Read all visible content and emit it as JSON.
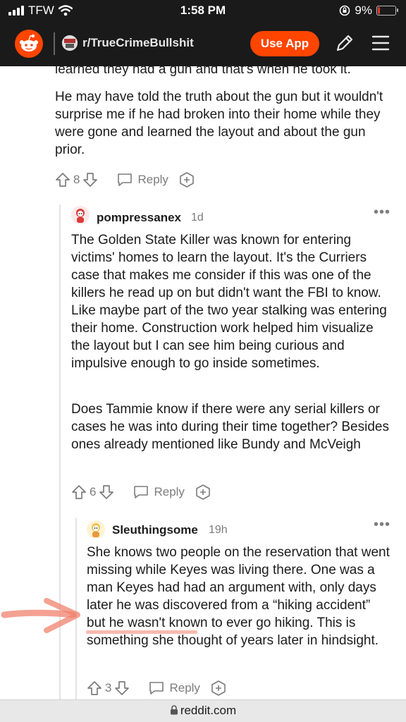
{
  "status": {
    "carrier": "TFW",
    "time": "1:58 PM",
    "battery": "9%",
    "battery_level": 0.09
  },
  "header": {
    "subreddit": "r/TrueCrimeBullshit",
    "use_app": "Use App"
  },
  "post_tail": {
    "clipped_line": "learned they had a gun and that's when he took it.",
    "paragraph": "He may have told the truth about the gun but it wouldn't surprise me if he had broken into their home while they were gone and learned the layout and about the gun prior.",
    "votes": "8",
    "reply": "Reply"
  },
  "comment1": {
    "username": "pompressanex",
    "time": "1d",
    "para1": "The Golden State Killer was known for entering victims' homes to learn the layout. It's the Curriers case that makes me consider if this was one of the killers he read up on but didn't want the FBI to know. Like maybe part of the two year stalking was entering their home. Construction work helped him visualize the layout but I can see him being curious and impulsive enough to go inside sometimes.",
    "para2": "Does Tammie know if there were any serial killers or cases he was into during their time together? Besides ones already mentioned like Bundy and McVeigh",
    "votes": "6",
    "reply": "Reply"
  },
  "comment2": {
    "username": "Sleuthingsome",
    "time": "19h",
    "para1": "She knows two people on the reservation that went missing while Keyes was living there. One was a man Keyes had had an argument with, only days later he was discovered from a “hiking accident” but he wasn't known to ever go hiking. This is something she thought of years later in hindsight.",
    "votes": "3",
    "reply": "Reply"
  },
  "url_bar": {
    "domain": "reddit.com"
  },
  "colors": {
    "brand": "#ff4500",
    "header_bg": "#1a1a1b",
    "text_muted": "#7c7c7c",
    "annotation_arrow": "#f0826e"
  },
  "icons": [
    "signal-icon",
    "wifi-icon",
    "lock-rotation-icon",
    "battery-icon",
    "reddit-logo-icon",
    "pencil-icon",
    "menu-icon",
    "upvote-icon",
    "downvote-icon",
    "reply-icon",
    "award-icon",
    "more-dots-icon",
    "lock-icon"
  ]
}
